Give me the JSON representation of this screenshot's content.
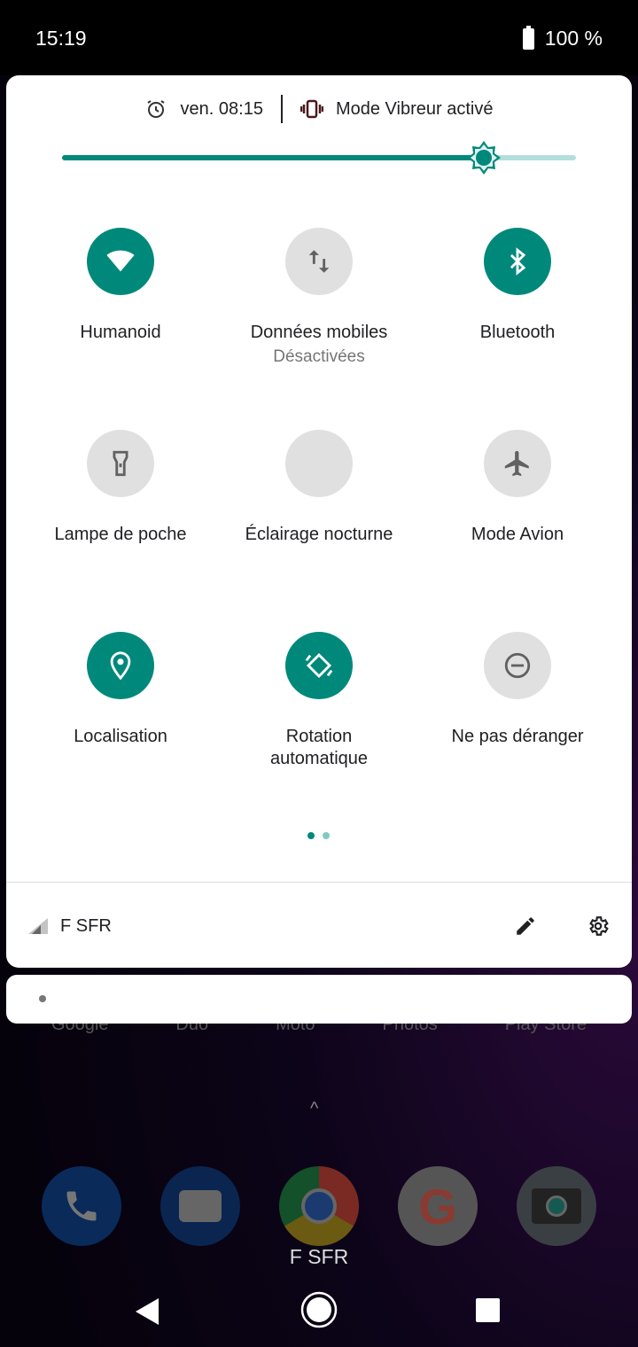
{
  "status_bar": {
    "time": "15:19",
    "battery": "100 %",
    "battery_icon": "battery-charging-icon"
  },
  "quick_settings": {
    "alarm": "ven. 08:15",
    "ringer": "Mode Vibreur activé",
    "brightness": 0.82,
    "accent_color": "#00897b",
    "tiles": [
      {
        "label": "Humanoid",
        "sub": "",
        "icon": "wifi-icon",
        "active": true
      },
      {
        "label": "Données mobiles",
        "sub": "Désactivées",
        "icon": "mobile-data-icon",
        "active": false
      },
      {
        "label": "Bluetooth",
        "sub": "",
        "icon": "bluetooth-icon",
        "active": true
      },
      {
        "label": "Lampe de poche",
        "sub": "",
        "icon": "flashlight-icon",
        "active": false
      },
      {
        "label": "Éclairage nocturne",
        "sub": "",
        "icon": "night-light-icon",
        "active": false
      },
      {
        "label": "Mode Avion",
        "sub": "",
        "icon": "airplane-icon",
        "active": false
      },
      {
        "label": "Localisation",
        "sub": "",
        "icon": "location-icon",
        "active": true
      },
      {
        "label": "Rotation",
        "sub": "automatique",
        "icon": "auto-rotate-icon",
        "active": true
      },
      {
        "label": "Ne pas déranger",
        "sub": "",
        "icon": "do-not-disturb-icon",
        "active": false
      }
    ],
    "page": 1,
    "pages": 2,
    "carrier": "F SFR"
  },
  "home": {
    "app_labels": [
      "Google",
      "Duo",
      "Moto",
      "Photos",
      "Play Store"
    ],
    "dock_carrier": "F SFR"
  }
}
